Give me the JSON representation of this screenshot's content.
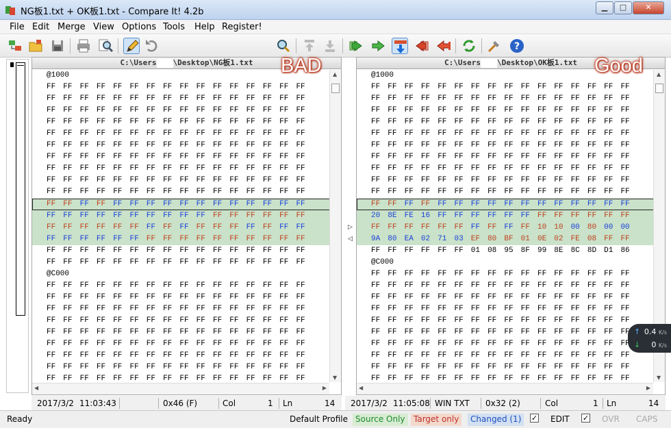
{
  "window": {
    "title": "NG板1.txt + OK板1.txt - Compare It! 4.2b"
  },
  "menu": [
    "File",
    "Edit",
    "Merge",
    "View",
    "Options",
    "Tools",
    "Help",
    "Register!"
  ],
  "toolbar": {
    "icons": [
      "compare-files-icon",
      "open-folder-icon",
      "save-icon",
      "print-icon",
      "find-icon",
      "edit-icon",
      "undo-icon",
      "search-icon",
      "prev-diff-icon",
      "next-diff-icon",
      "copy-right-icon",
      "copy-line-right-icon",
      "merge-down-icon",
      "copy-left-icon",
      "copy-line-left-icon",
      "recompare-icon",
      "tools-icon",
      "help-icon"
    ],
    "combo_value": ""
  },
  "left": {
    "path_start": "C:\\Users",
    "path_end": "\\Desktop\\NG板1.txt",
    "stamp": "BAD",
    "status": {
      "date": "2017/3/2",
      "time": "11:03:43",
      "offset": "0x46 (F)",
      "col_label": "Col",
      "col": "1",
      "ln_label": "Ln",
      "ln": "14"
    }
  },
  "right": {
    "path_start": "C:\\Users",
    "path_end": "\\Desktop\\OK板1.txt",
    "stamp": "Good",
    "status": {
      "date": "2017/3/2",
      "time": "11:05:08",
      "enc": "WIN TXT",
      "offset": "0x32 (2)",
      "col_label": "Col",
      "col": "1",
      "ln_label": "Ln",
      "ln": "14"
    }
  },
  "hex_left": [
    "@1000",
    "FF FF FF FF FF FF FF FF FF FF FF FF FF FF FF FF",
    "FF FF FF FF FF FF FF FF FF FF FF FF FF FF FF FF",
    "FF FF FF FF FF FF FF FF FF FF FF FF FF FF FF FF",
    "FF FF FF FF FF FF FF FF FF FF FF FF FF FF FF FF",
    "FF FF FF FF FF FF FF FF FF FF FF FF FF FF FF FF",
    "FF FF FF FF FF FF FF FF FF FF FF FF FF FF FF FF",
    "FF FF FF FF FF FF FF FF FF FF FF FF FF FF FF FF",
    "FF FF FF FF FF FF FF FF FF FF FF FF FF FF FF FF",
    "FF FF FF FF FF FF FF FF FF FF FF FF FF FF FF FF",
    "FF FF FF FF FF FF FF FF FF FF FF FF FF FF FF FF",
    "FF FF FF FF FF FF FF FF FF FF FF FF FF FF FF FF",
    "FF FF FF FF FF FF FF FF FF FF FF FF FF FF FF FF",
    "FF FF FF FF FF FF FF FF FF FF FF FF FF FF FF FF",
    "FF FF FF FF FF FF FF FF FF FF FF FF FF FF FF FF",
    "FF FF FF FF FF FF FF FF FF FF FF FF FF FF FF FF",
    "FF FF FF FF FF FF FF FF FF FF FF FF FF FF FF FF",
    "@C000",
    "FF FF FF FF FF FF FF FF FF FF FF FF FF FF FF FF",
    "FF FF FF FF FF FF FF FF FF FF FF FF FF FF FF FF",
    "FF FF FF FF FF FF FF FF FF FF FF FF FF FF FF FF",
    "FF FF FF FF FF FF FF FF FF FF FF FF FF FF FF FF",
    "FF FF FF FF FF FF FF FF FF FF FF FF FF FF FF FF",
    "FF FF FF FF FF FF FF FF FF FF FF FF FF FF FF FF",
    "FF FF FF FF FF FF FF FF FF FF FF FF FF FF FF FF",
    "FF FF FF FF FF FF FF FF FF FF FF FF FF FF FF FF",
    "FF FF FF FF FF FF FF FF FF FF FF FF FF FF FF FF"
  ],
  "hex_right": [
    "@1000",
    "FF FF FF FF FF FF FF FF FF FF FF FF FF FF FF FF",
    "FF FF FF FF FF FF FF FF FF FF FF FF FF FF FF FF",
    "FF FF FF FF FF FF FF FF FF FF FF FF FF FF FF FF",
    "FF FF FF FF FF FF FF FF FF FF FF FF FF FF FF FF",
    "FF FF FF FF FF FF FF FF FF FF FF FF FF FF FF FF",
    "FF FF FF FF FF FF FF FF FF FF FF FF FF FF FF FF",
    "FF FF FF FF FF FF FF FF FF FF FF FF FF FF FF FF",
    "FF FF FF FF FF FF FF FF FF FF FF FF FF FF FF FF",
    "FF FF FF FF FF FF FF FF FF FF FF FF FF FF FF FF",
    "FF FF FF FF FF FF FF FF FF FF FF FF FF FF FF FF",
    "FF FF FF FF FF FF FF FF FF FF FF FF FF FF FF FF",
    "20 8E FE 16 FF FF FF FF FF FF FF FF FF FF FF FF",
    "FF FF FF FF FF FF FF FF FF FF 10 10 00 80 00 00",
    "9A 80 EA 02 71 03 EF 80 BF 01 0E 02 FE 08 FF FF",
    "FF FF FF FF FF FF 01 08 95 8F 99 8E 8C 8D D1 86",
    "@C000",
    "FF FF FF FF FF FF FF FF FF FF FF FF FF FF FF FF",
    "FF FF FF FF FF FF FF FF FF FF FF FF FF FF FF FF",
    "FF FF FF FF FF FF FF FF FF FF FF FF FF FF FF FF",
    "FF FF FF FF FF FF FF FF FF FF FF FF FF FF FF FF",
    "FF FF FF FF FF FF FF FF FF FF FF FF FF FF FF FF",
    "FF FF FF FF FF FF FF FF FF FF FF FF FF FF FF FF",
    "FF FF FF FF FF FF FF FF FF FF FF FF FF FF FF FF",
    "FF FF FF FF FF FF FF FF FF FF FF FF FF FF FF FF",
    "FF FF FF FF FF FF FF FF FF FF FF FF FF FF FF FF",
    "FF FF FF FF FF FF FF FF FF FF FF FF FF FF FF FF",
    "FF FF FF FF FF FF FF FF FF FF FF FF FF FF FF FF"
  ],
  "diff": {
    "rows": [
      11,
      12,
      13,
      14
    ],
    "current_row": 11,
    "left_colors": [
      "rrbrbbbbbbbbbbbb",
      "bbbbbbbbbbrrrrrr",
      "rrrrrrbrbrrrbrbb",
      "bbbbbbrrrrrrrrrr"
    ],
    "right_colors": [
      "rrbrbbbbbbbbbbbb",
      "bbbbbbbbbbrrrrrr",
      "rrrrrrbrbrrrbrbb",
      "bbbbbbrrrrrrrrrr"
    ]
  },
  "statusbar": {
    "ready": "Ready",
    "profile": "Default Profile",
    "source_only": "Source Only",
    "target_only": "Target only",
    "changed": "Changed (1)",
    "edit": "EDIT",
    "ovr": "OVR",
    "caps": "CAPS",
    "colors": {
      "source": "#1e8a2e",
      "target": "#c0302a",
      "changed": "#1f4fbf",
      "source_bg": "#d7ecd2",
      "target_bg": "#f2d9cc",
      "changed_bg": "#d2e0f1"
    }
  },
  "network": {
    "up": "↑",
    "up_value": "0.4",
    "down": "↓",
    "down_value": "0",
    "unit": "K/s"
  }
}
